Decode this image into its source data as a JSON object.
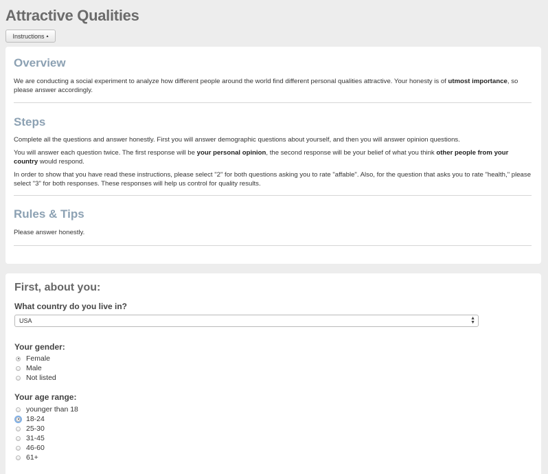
{
  "page": {
    "title": "Attractive Qualities"
  },
  "instructions_button": {
    "label": "Instructions",
    "caret": "▴"
  },
  "overview": {
    "title": "Overview",
    "text_before": "We are conducting a social experiment to analyze how different people around the world find different personal qualities attractive. Your honesty is of ",
    "text_bold": "utmost importance",
    "text_after": ", so please answer accordingly."
  },
  "steps": {
    "title": "Steps",
    "p1": "Complete all the questions and answer honestly. First you will answer demographic questions about yourself, and then you will answer opinion questions.",
    "p2_a": "You will answer each question twice. The first response will be ",
    "p2_b": "your personal opinion",
    "p2_c": ", the second response will be your belief of what you think ",
    "p2_d": "other people from your country",
    "p2_e": " would respond.",
    "p3": "In order to show that you have read these instructions, please select \"2\" for both questions asking you to rate \"affable\". Also, for the question that asks you to rate \"health,\" please select \"3\" for both responses. These responses will help us control for quality results."
  },
  "rules": {
    "title": "Rules & Tips",
    "text": "Please answer honestly."
  },
  "about": {
    "title": "First, about you:",
    "country_label": "What country do you live in?",
    "country_value": "USA",
    "gender_label": "Your gender:",
    "gender_options": [
      "Female",
      "Male",
      "Not listed"
    ],
    "gender_selected": "Female",
    "age_label": "Your age range:",
    "age_options": [
      "younger than 18",
      "18-24",
      "25-30",
      "31-45",
      "46-60",
      "61+"
    ],
    "age_selected": "18-24"
  }
}
